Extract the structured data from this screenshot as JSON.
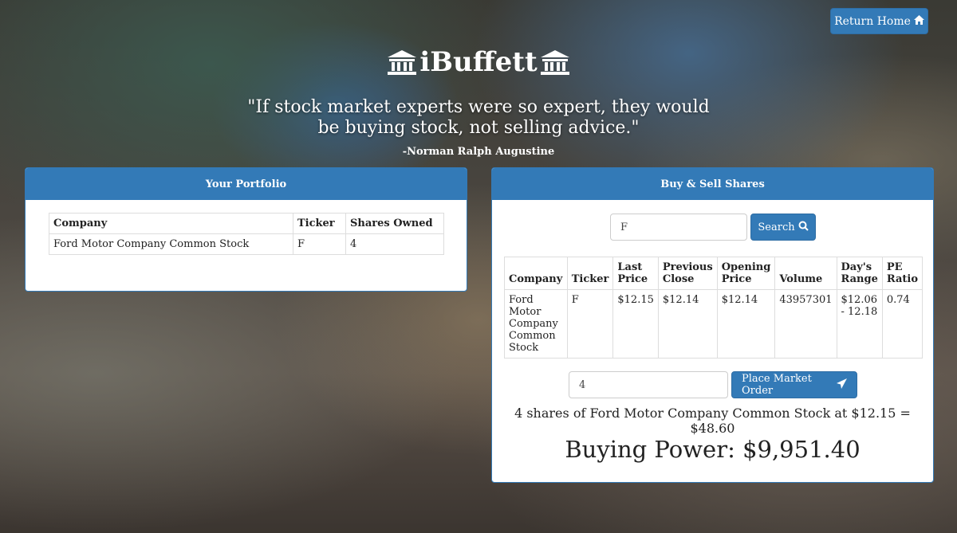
{
  "nav": {
    "return_home": "Return Home"
  },
  "brand": {
    "name": "iBuffett"
  },
  "quote": {
    "text": "\"If stock market experts were so expert, they would be buying stock, not selling advice.\"",
    "author": "-Norman Ralph Augustine"
  },
  "portfolio": {
    "title": "Your Portfolio",
    "columns": [
      "Company",
      "Ticker",
      "Shares Owned"
    ],
    "rows": [
      {
        "company": "Ford Motor Company Common Stock",
        "ticker": "F",
        "shares": "4"
      }
    ]
  },
  "trade": {
    "title": "Buy & Sell Shares",
    "search": {
      "value": "F",
      "button": "Search"
    },
    "columns": [
      "Company",
      "Ticker",
      "Last Price",
      "Previous Close",
      "Opening Price",
      "Volume",
      "Day's Range",
      "PE Ratio"
    ],
    "quote_row": {
      "company": "Ford Motor Company Common Stock",
      "ticker": "F",
      "last_price": "$12.15",
      "previous_close": "$12.14",
      "opening_price": "$12.14",
      "volume": "43957301",
      "days_range": "$12.06 - 12.18",
      "pe_ratio": "0.74"
    },
    "order": {
      "quantity": "4",
      "button": "Place Market Order"
    },
    "summary": "4 shares of Ford Motor Company Common Stock at $12.15 = $48.60",
    "buying_power": "Buying Power: $9,951.40"
  },
  "colors": {
    "accent": "#337ab7",
    "panel_bg": "#ffffff"
  }
}
